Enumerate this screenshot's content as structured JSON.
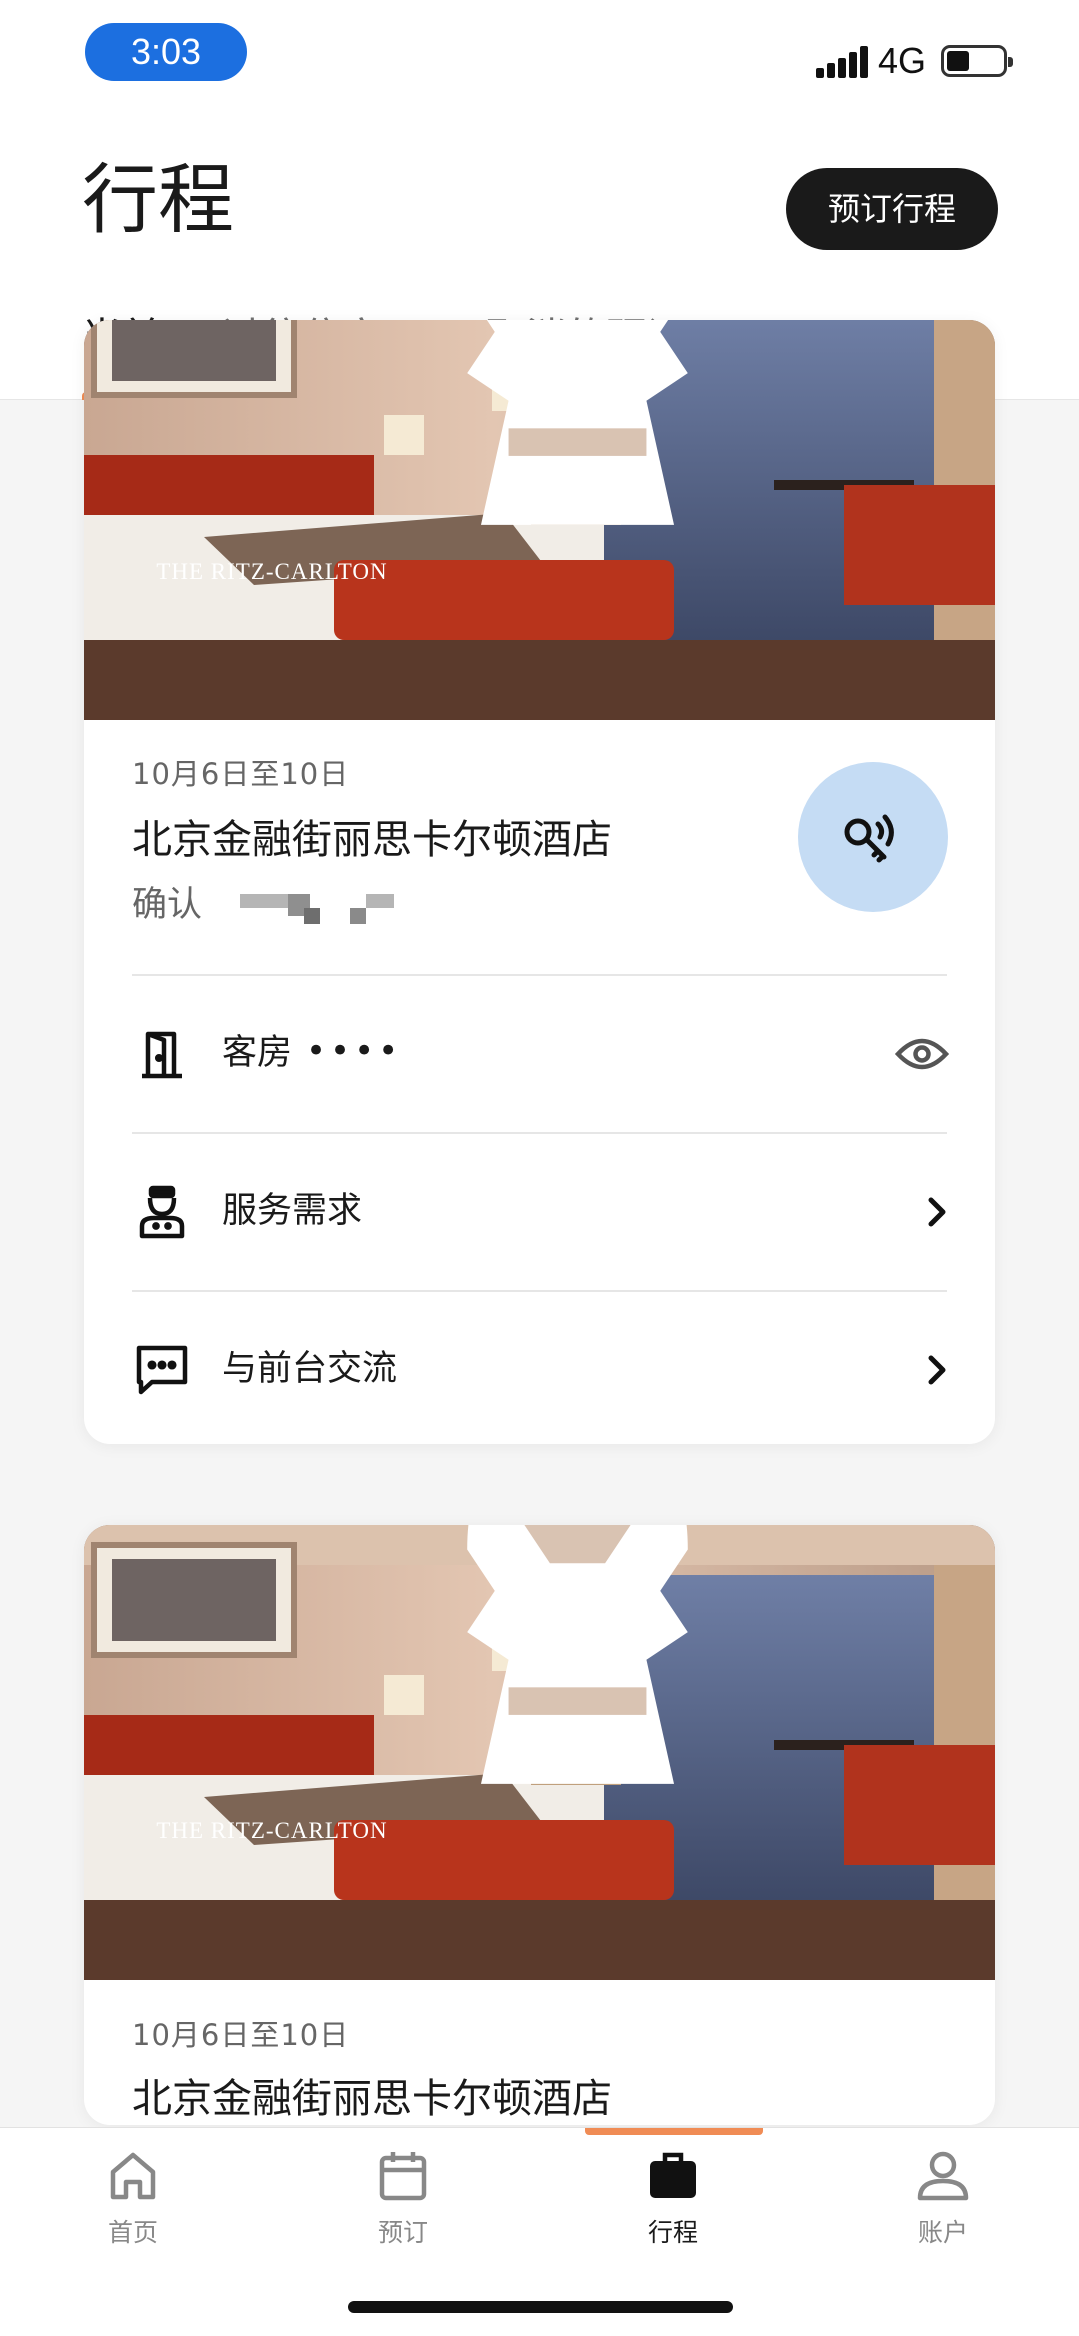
{
  "status_bar": {
    "time": "3:03",
    "network": "4G",
    "battery_level": 0.4,
    "icons": [
      "signal-icon",
      "battery-icon"
    ]
  },
  "header": {
    "title": "行程",
    "book_button": "预订行程",
    "tabs": [
      {
        "label": "当前",
        "active": true
      },
      {
        "label": "过往住宿",
        "active": false
      },
      {
        "label": "已取消的预订",
        "active": false
      }
    ]
  },
  "trips": [
    {
      "brand": "THE RITZ-CARLTON",
      "dates": "10月6日至10日",
      "hotel": "北京金融街丽思卡尔顿酒店",
      "confirmation_label": "确认",
      "key_icon": "digital-key-icon",
      "rows": [
        {
          "icon": "door-icon",
          "label": "客房",
          "value": "••••",
          "trailing": "eye-icon"
        },
        {
          "icon": "bellhop-icon",
          "label": "服务需求",
          "trailing": "chevron-right-icon"
        },
        {
          "icon": "chat-icon",
          "label": "与前台交流",
          "trailing": "chevron-right-icon"
        }
      ]
    },
    {
      "brand": "THE RITZ-CARLTON",
      "dates": "10月6日至10日",
      "hotel": "北京金融街丽思卡尔顿酒店"
    }
  ],
  "bottom_nav": {
    "items": [
      {
        "label": "首页",
        "icon": "home-icon",
        "active": false
      },
      {
        "label": "预订",
        "icon": "calendar-icon",
        "active": false
      },
      {
        "label": "行程",
        "icon": "briefcase-icon",
        "active": true
      },
      {
        "label": "账户",
        "icon": "account-icon",
        "active": false
      }
    ]
  },
  "colors": {
    "accent": "#f08c55",
    "time_pill": "#1c6fe0",
    "key_button": "#c5dcf4",
    "primary_button": "#1a1a1a"
  }
}
